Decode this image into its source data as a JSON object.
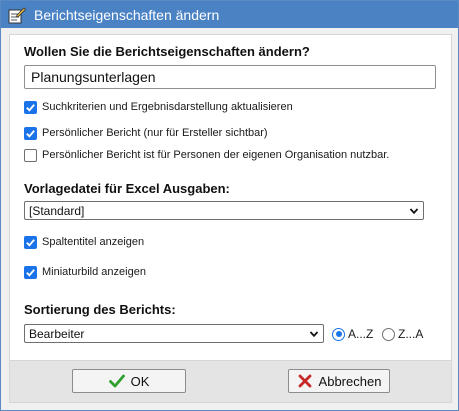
{
  "window": {
    "title": "Berichtseigenschaften ändern",
    "icon": "edit-document-icon"
  },
  "form": {
    "question": "Wollen Sie die Berichtseigenschaften ändern?",
    "name_value": "Planungsunterlagen",
    "checkboxes": [
      {
        "label": "Suchkriterien und Ergebnisdarstellung aktualisieren",
        "checked": true
      },
      {
        "label": "Persönlicher Bericht (nur für Ersteller sichtbar)",
        "checked": true
      },
      {
        "label": "Persönlicher Bericht ist für Personen der eigenen Organisation nutzbar.",
        "checked": false
      }
    ],
    "template_heading": "Vorlagedatei für Excel Ausgaben:",
    "template_value": "[Standard]",
    "column_titles": {
      "label": "Spaltentitel anzeigen",
      "checked": true
    },
    "thumbnail": {
      "label": "Miniaturbild anzeigen",
      "checked": true
    },
    "sort_heading": "Sortierung des Berichts:",
    "sort_value": "Bearbeiter",
    "sort_asc": {
      "label": "A...Z",
      "selected": true
    },
    "sort_desc": {
      "label": "Z...A",
      "selected": false
    }
  },
  "buttons": {
    "ok": "OK",
    "cancel": "Abbrechen"
  },
  "colors": {
    "titlebar": "#4a82c4",
    "accent": "#1a73e8",
    "ok_icon": "#2ea02e",
    "cancel_icon": "#c62828"
  }
}
